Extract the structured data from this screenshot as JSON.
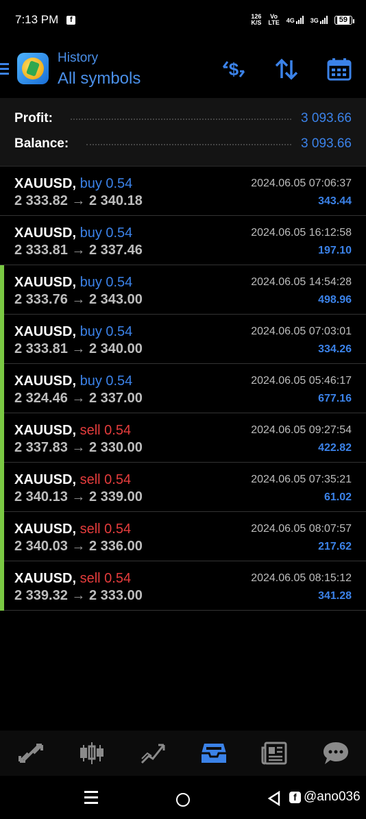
{
  "status_bar": {
    "time": "7:13 PM",
    "net_speed_top": "126",
    "net_speed_unit": "K/S",
    "volte_top": "Vo",
    "volte_bottom": "LTE",
    "net1": "4G",
    "net2": "3G",
    "battery": "59"
  },
  "header": {
    "subtitle": "History",
    "title": "All symbols",
    "icons": [
      "deposit-filter-icon",
      "sort-icon",
      "calendar-icon"
    ]
  },
  "summary": {
    "profit_label": "Profit:",
    "profit_value": "3 093.66",
    "balance_label": "Balance:",
    "balance_value": "3 093.66"
  },
  "trades": [
    {
      "symbol": "XAUUSD,",
      "direction": "buy",
      "volume": "buy 0.54",
      "open": "2 333.82",
      "close": "2 340.18",
      "date": "2024.06.05 07:06:37",
      "profit": "343.44",
      "marked": false
    },
    {
      "symbol": "XAUUSD,",
      "direction": "buy",
      "volume": "buy 0.54",
      "open": "2 333.81",
      "close": "2 337.46",
      "date": "2024.06.05 16:12:58",
      "profit": "197.10",
      "marked": false
    },
    {
      "symbol": "XAUUSD,",
      "direction": "buy",
      "volume": "buy 0.54",
      "open": "2 333.76",
      "close": "2 343.00",
      "date": "2024.06.05 14:54:28",
      "profit": "498.96",
      "marked": true
    },
    {
      "symbol": "XAUUSD,",
      "direction": "buy",
      "volume": "buy 0.54",
      "open": "2 333.81",
      "close": "2 340.00",
      "date": "2024.06.05 07:03:01",
      "profit": "334.26",
      "marked": true
    },
    {
      "symbol": "XAUUSD,",
      "direction": "buy",
      "volume": "buy 0.54",
      "open": "2 324.46",
      "close": "2 337.00",
      "date": "2024.06.05 05:46:17",
      "profit": "677.16",
      "marked": true
    },
    {
      "symbol": "XAUUSD,",
      "direction": "sell",
      "volume": "sell 0.54",
      "open": "2 337.83",
      "close": "2 330.00",
      "date": "2024.06.05 09:27:54",
      "profit": "422.82",
      "marked": true
    },
    {
      "symbol": "XAUUSD,",
      "direction": "sell",
      "volume": "sell 0.54",
      "open": "2 340.13",
      "close": "2 339.00",
      "date": "2024.06.05 07:35:21",
      "profit": "61.02",
      "marked": true
    },
    {
      "symbol": "XAUUSD,",
      "direction": "sell",
      "volume": "sell 0.54",
      "open": "2 340.03",
      "close": "2 336.00",
      "date": "2024.06.05 08:07:57",
      "profit": "217.62",
      "marked": true
    },
    {
      "symbol": "XAUUSD,",
      "direction": "sell",
      "volume": "sell 0.54",
      "open": "2 339.32",
      "close": "2 333.00",
      "date": "2024.06.05 08:15:12",
      "profit": "341.28",
      "marked": true
    }
  ],
  "price_arrow": "→",
  "tabs": [
    {
      "name": "quotes-tab",
      "icon": "quotes-arrows-icon",
      "active": false
    },
    {
      "name": "chart-tab",
      "icon": "candlestick-icon",
      "active": false
    },
    {
      "name": "trade-tab",
      "icon": "trend-icon",
      "active": false
    },
    {
      "name": "history-tab",
      "icon": "inbox-icon",
      "active": true
    },
    {
      "name": "news-tab",
      "icon": "newspaper-icon",
      "active": false
    },
    {
      "name": "chat-tab",
      "icon": "chat-bubble-icon",
      "active": false
    }
  ],
  "watermark": "@ano036",
  "colors": {
    "accent": "#3b82e8",
    "buy": "#3b82e8",
    "sell": "#e43c3c",
    "marker": "#7ac943"
  }
}
